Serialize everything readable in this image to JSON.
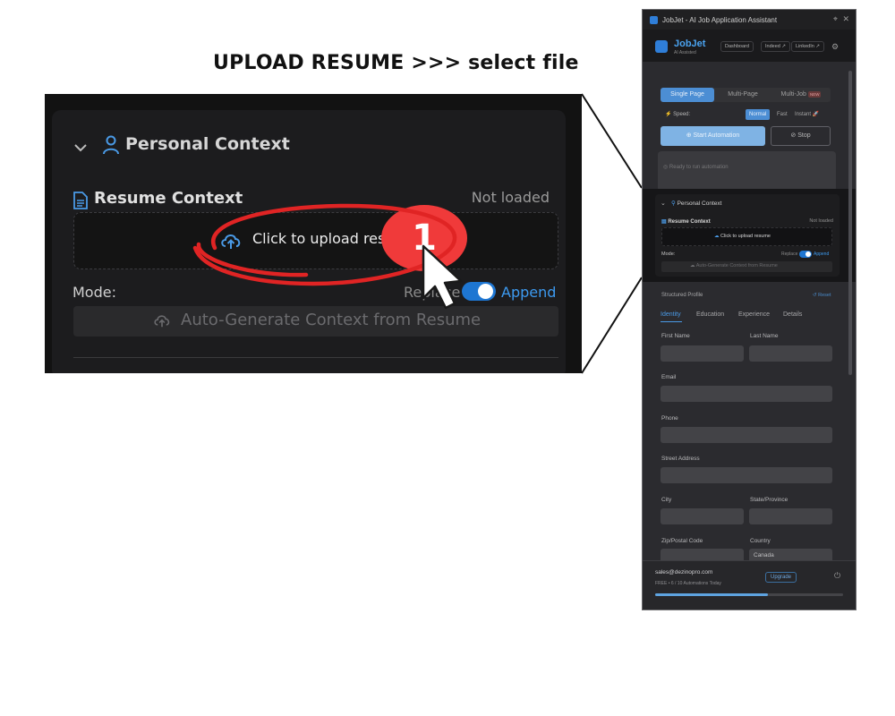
{
  "headline": "UPLOAD RESUME >>> select file",
  "step_badge": "1",
  "zoom": {
    "section_title": "Personal Context",
    "resume_title": "Resume Context",
    "resume_status": "Not loaded",
    "upload_label": "Click to upload resume",
    "mode_label": "Mode:",
    "replace_label": "Replace",
    "append_label": "Append",
    "autogen_label": "Auto-Generate Context from Resume"
  },
  "panel": {
    "window_title": "JobJet - AI Job Application Assistant",
    "pin_icon": "pin-icon",
    "close_glyph": "✕",
    "brand": "JobJet",
    "brand_sub": "AI Assisted",
    "nav": [
      "Dashboard",
      "Indeed ↗",
      "LinkedIn ↗"
    ],
    "tabs": [
      "Single Page",
      "Multi-Page",
      "Multi-Job"
    ],
    "new_badge": "NEW",
    "speed_label": "Speed:",
    "speeds": [
      "Normal",
      "Fast",
      "Instant"
    ],
    "start_label": "Start Automation",
    "stop_label": "Stop",
    "status_text": "Ready to run automation",
    "personal_context": "Personal Context",
    "resume_context": "Resume Context",
    "resume_status": "Not loaded",
    "upload_label": "Click to upload resume",
    "mode_label": "Mode:",
    "replace_label": "Replace",
    "append_label": "Append",
    "autogen_label": "Auto-Generate Context from Resume",
    "profile_title": "Structured Profile",
    "reset_label": "↺ Reset",
    "profile_tabs": [
      "Identity",
      "Education",
      "Experience",
      "Details"
    ],
    "fields": {
      "first_name": "First Name",
      "last_name": "Last Name",
      "email": "Email",
      "phone": "Phone",
      "street": "Street Address",
      "city": "City",
      "state": "State/Province",
      "zip": "Zip/Postal Code",
      "country": "Country",
      "country_value": "Canada"
    },
    "footer": {
      "email": "sales@dezinopro.com",
      "plan": "FREE • 6 / 10 Automations Today",
      "upgrade": "Upgrade",
      "usage_used": 6,
      "usage_limit": 10
    }
  },
  "colors": {
    "accent": "#2f7ed8",
    "badge": "#f03a3a",
    "toggle_on": "#1e76d2",
    "append": "#3d9af0",
    "scribble": "#e02424"
  }
}
